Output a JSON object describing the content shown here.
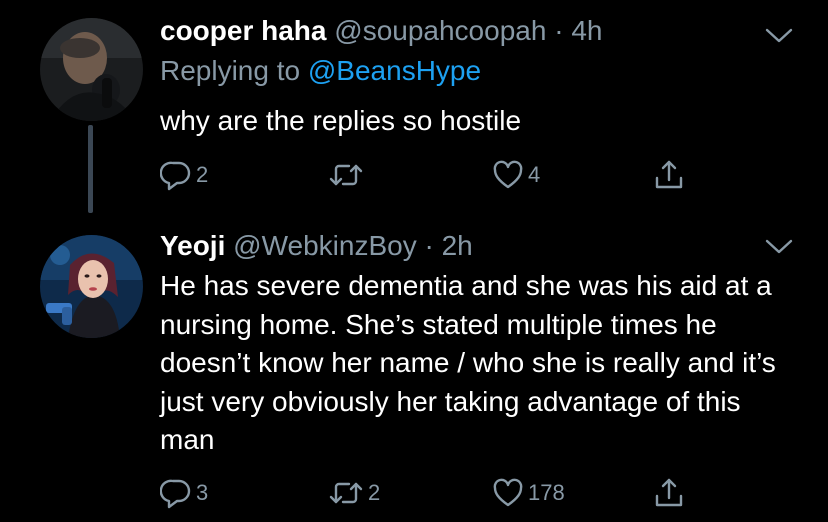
{
  "tweets": [
    {
      "display_name": "cooper haha",
      "handle": "@soupahcoopah",
      "separator": "·",
      "time": "4h",
      "replying_prefix": "Replying to",
      "replying_to": "@BeansHype",
      "text": "why are the replies so hostile",
      "replies": "2",
      "retweets": "",
      "likes": "4",
      "avatar": "profile-photo-dark"
    },
    {
      "display_name": "Yeoji",
      "handle": "@WebkinzBoy",
      "separator": "·",
      "time": "2h",
      "text": "He has severe dementia and she was his aid at a nursing home. She’s stated multiple times he doesn’t know her name / who she is really and it’s just very obviously her taking advantage of this man",
      "replies": "3",
      "retweets": "2",
      "likes": "178",
      "avatar": "profile-photo-blue"
    }
  ],
  "icons": {
    "reply": "reply-icon",
    "retweet": "retweet-icon",
    "like": "like-icon",
    "share": "share-icon",
    "caret": "chevron-down-icon"
  },
  "colors": {
    "background": "#000000",
    "text": "#ffffff",
    "secondary": "#8899a6",
    "link": "#1da1f2",
    "thread_line": "#3b4754"
  }
}
